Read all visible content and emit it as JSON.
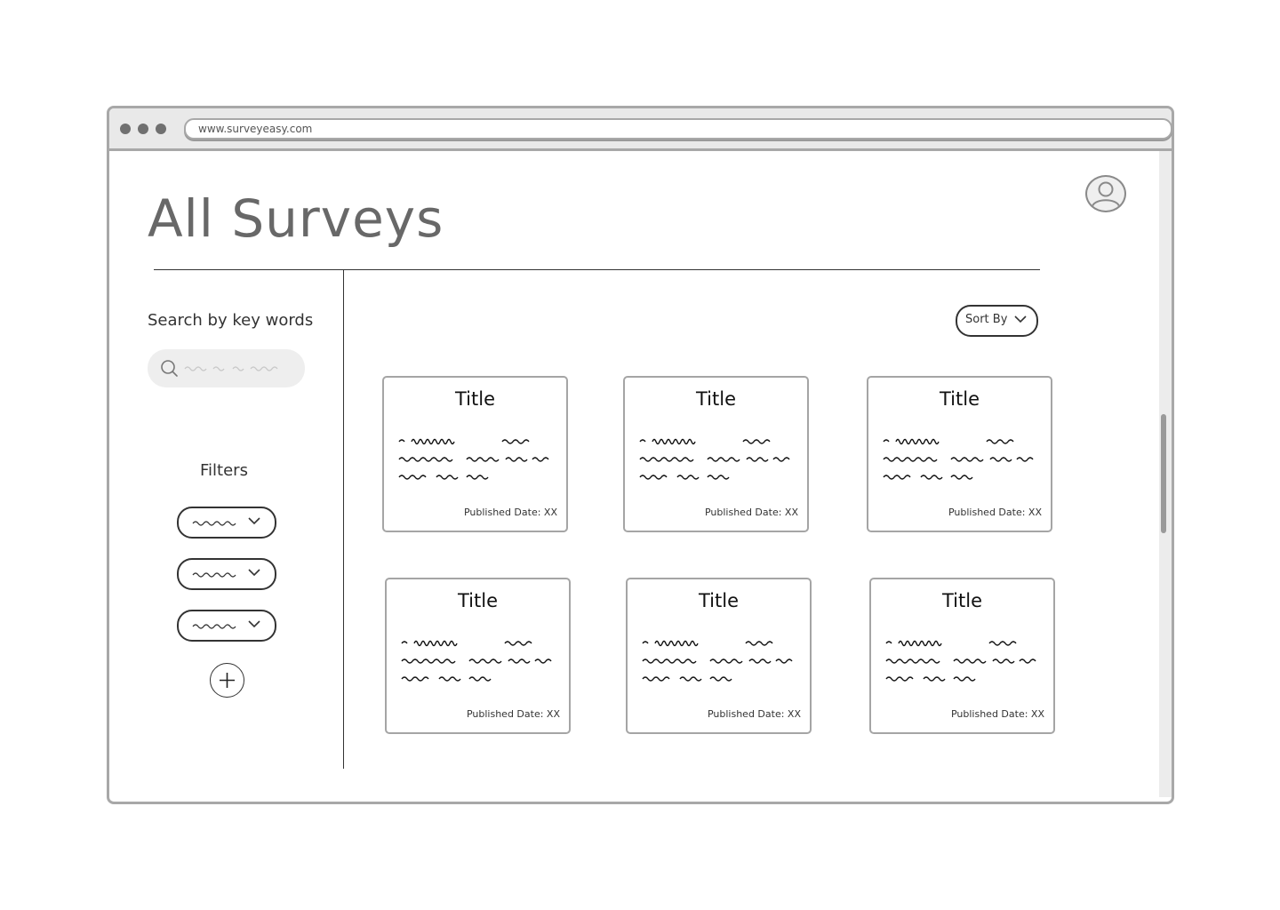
{
  "browser": {
    "url": "www.surveyeasy.com"
  },
  "page": {
    "title": "All Surveys"
  },
  "sidebar": {
    "search_label": "Search by key words",
    "filters_label": "Filters"
  },
  "toolbar": {
    "sort_label": "Sort By"
  },
  "cards": [
    {
      "title": "Title",
      "date": "Published Date: XX"
    },
    {
      "title": "Title",
      "date": "Published Date: XX"
    },
    {
      "title": "Title",
      "date": "Published Date: XX"
    },
    {
      "title": "Title",
      "date": "Published Date: XX"
    },
    {
      "title": "Title",
      "date": "Published Date: XX"
    },
    {
      "title": "Title",
      "date": "Published Date: XX"
    }
  ],
  "icons": {
    "search": "search-icon",
    "avatar": "user-icon",
    "chevron": "chevron-down-icon",
    "add": "plus-icon"
  },
  "colors": {
    "frame": "#a8a8a8",
    "title_text": "#686868",
    "search_bg": "#eeeeee"
  }
}
